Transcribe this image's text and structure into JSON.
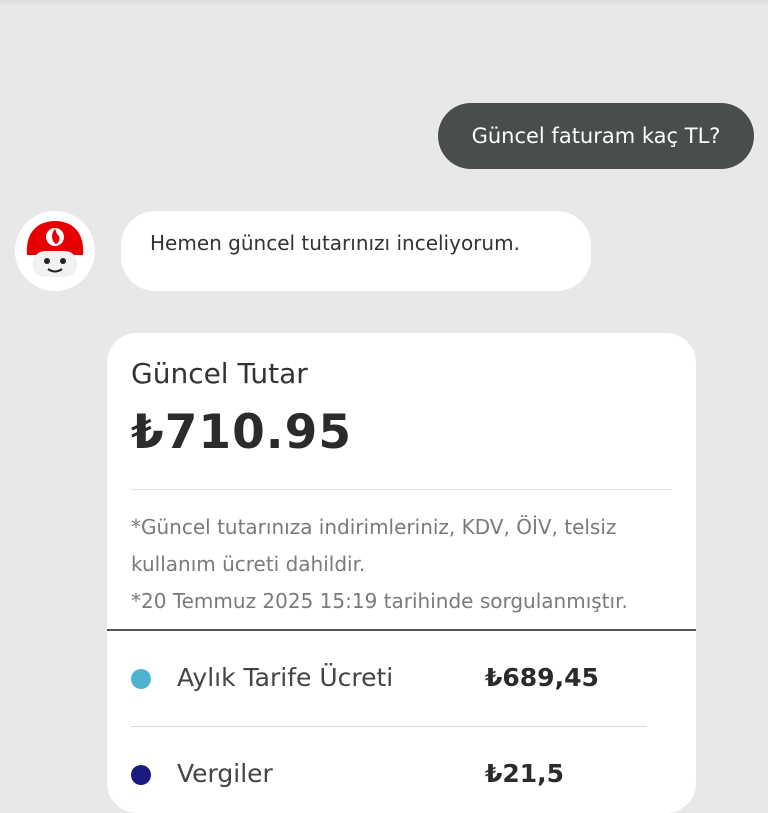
{
  "chat": {
    "user_message": "Güncel faturam kaç TL?",
    "bot_message": "Hemen güncel tutarınızı inceliyorum."
  },
  "bill_card": {
    "title": "Güncel Tutar",
    "amount": "₺710.95",
    "note_1": "*Güncel tutarınıza indirimleriniz, KDV, ÖİV, telsiz kullanım ücreti dahildir.",
    "note_2": "*20 Temmuz 2025 15:19 tarihinde sorgulanmıştır.",
    "items": [
      {
        "label": "Aylık Tarife Ücreti",
        "value": "₺689,45",
        "dot_color": "#4fb3d0"
      },
      {
        "label": "Vergiler",
        "value": "₺21,5",
        "dot_color": "#1a1a80"
      }
    ]
  },
  "colors": {
    "background": "#e8e8e8",
    "user_bubble": "#4a4d4e",
    "brand_red": "#e60000"
  },
  "avatar": {
    "icon": "vodafone-mascot-icon"
  }
}
